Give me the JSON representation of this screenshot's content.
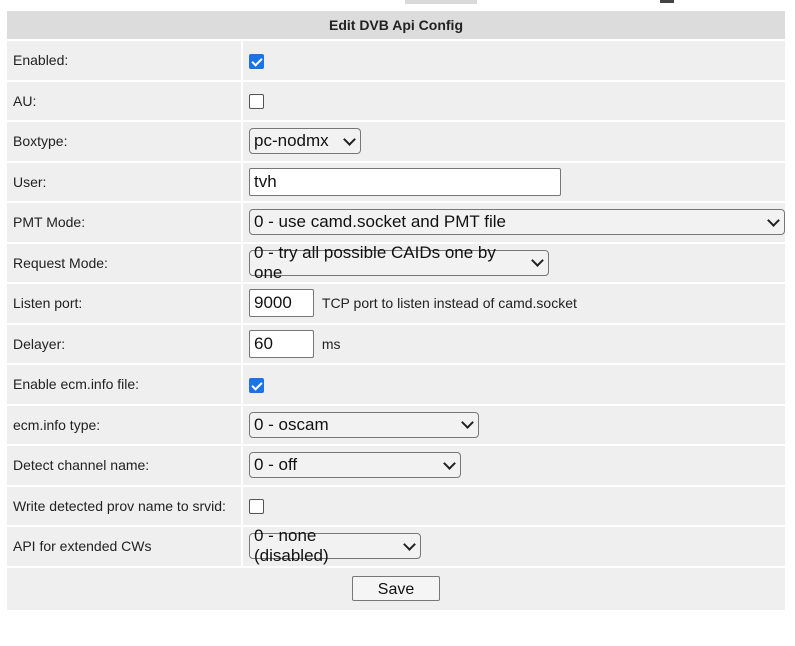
{
  "header": {
    "title": "Edit DVB Api Config"
  },
  "fields": {
    "enabled": {
      "label": "Enabled:",
      "checked": true
    },
    "au": {
      "label": "AU:",
      "checked": false
    },
    "boxtype": {
      "label": "Boxtype:",
      "value": "pc-nodmx"
    },
    "user": {
      "label": "User:",
      "value": "tvh"
    },
    "pmt_mode": {
      "label": "PMT Mode:",
      "value": "0 - use camd.socket and PMT file"
    },
    "request_mode": {
      "label": "Request Mode:",
      "value": "0 - try all possible CAIDs one by one"
    },
    "listen_port": {
      "label": "Listen port:",
      "value": "9000",
      "hint": "TCP port to listen instead of camd.socket"
    },
    "delayer": {
      "label": "Delayer:",
      "value": "60",
      "unit": "ms"
    },
    "ecm_info_file": {
      "label": "Enable ecm.info file:",
      "checked": true
    },
    "ecm_info_type": {
      "label": "ecm.info type:",
      "value": "0 - oscam"
    },
    "detect_channel_name": {
      "label": "Detect channel name:",
      "value": "0 - off"
    },
    "write_prov_name": {
      "label": "Write detected prov name to srvid:",
      "checked": false
    },
    "api_extended_cws": {
      "label": "API for extended CWs",
      "value": "0 - none (disabled)"
    }
  },
  "actions": {
    "save_label": "Save"
  },
  "colors": {
    "checkbox_checked": "#1a73e8",
    "row_background": "#efefef",
    "header_background": "#dcdcdc"
  }
}
